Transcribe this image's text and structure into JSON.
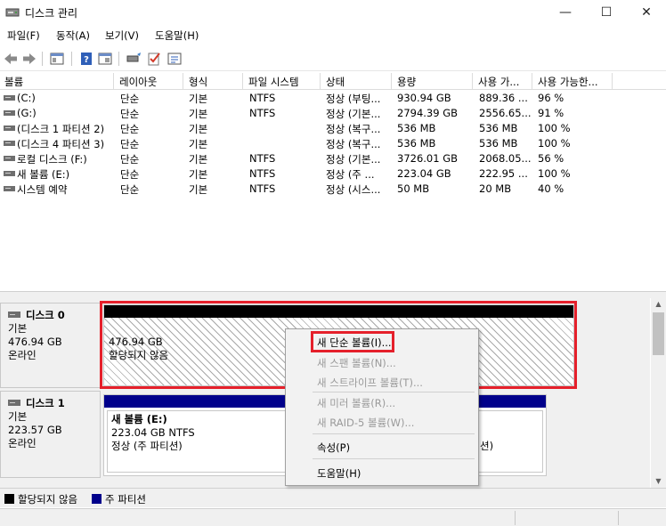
{
  "window": {
    "title": "디스크 관리",
    "minimize": "—",
    "maximize": "☐",
    "close": "✕"
  },
  "menu": [
    "파일(F)",
    "동작(A)",
    "보기(V)",
    "도움말(H)"
  ],
  "volumes": {
    "columns": [
      "볼륨",
      "레이아웃",
      "형식",
      "파일 시스템",
      "상태",
      "용량",
      "사용 가...",
      "사용 가능한..."
    ],
    "rows": [
      [
        "(C:)",
        "단순",
        "기본",
        "NTFS",
        "정상 (부팅...",
        "930.94 GB",
        "889.36 ...",
        "96 %"
      ],
      [
        "(G:)",
        "단순",
        "기본",
        "NTFS",
        "정상 (기본...",
        "2794.39 GB",
        "2556.65...",
        "91 %"
      ],
      [
        "(디스크 1 파티션 2)",
        "단순",
        "기본",
        "",
        "정상 (복구...",
        "536 MB",
        "536 MB",
        "100 %"
      ],
      [
        "(디스크 4 파티션 3)",
        "단순",
        "기본",
        "",
        "정상 (복구...",
        "536 MB",
        "536 MB",
        "100 %"
      ],
      [
        "로컬 디스크 (F:)",
        "단순",
        "기본",
        "NTFS",
        "정상 (기본...",
        "3726.01 GB",
        "2068.05...",
        "56 %"
      ],
      [
        "새 볼륨 (E:)",
        "단순",
        "기본",
        "NTFS",
        "정상 (주 ...",
        "223.04 GB",
        "222.95 ...",
        "100 %"
      ],
      [
        "시스템 예약",
        "단순",
        "기본",
        "NTFS",
        "정상 (시스...",
        "50 MB",
        "20 MB",
        "40 %"
      ]
    ]
  },
  "disks": [
    {
      "name": "디스크 0",
      "type": "기본",
      "size": "476.94 GB",
      "status": "온라인",
      "partition": {
        "size": "476.94 GB",
        "desc": "할당되지 않음"
      }
    },
    {
      "name": "디스크 1",
      "type": "기본",
      "size": "223.57 GB",
      "status": "온라인",
      "partition": {
        "title": "새 볼륨  (E:)",
        "size": "223.04 GB NTFS",
        "status": "정상 (주 파티션)"
      },
      "partition2": {
        "status_tail": "션)"
      }
    }
  ],
  "context_menu": {
    "items": [
      {
        "label": "새 단순 볼륨(I)...",
        "enabled": true
      },
      {
        "label": "새 스팬 볼륨(N)...",
        "enabled": false
      },
      {
        "label": "새 스트라이프 볼륨(T)...",
        "enabled": false
      },
      {
        "label": "새 미러 볼륨(R)...",
        "enabled": false
      },
      {
        "label": "새 RAID-5 볼륨(W)...",
        "enabled": false
      },
      {
        "label": "속성(P)",
        "enabled": true
      },
      {
        "label": "도움말(H)",
        "enabled": true
      }
    ]
  },
  "legend": {
    "unallocated": "할당되지 않음",
    "primary": "주 파티션"
  },
  "colors": {
    "unallocated": "#000000",
    "primary": "#00008b",
    "highlight": "#e5202b"
  },
  "icons": [
    "app-icon",
    "back-icon",
    "forward-icon",
    "panel-icon",
    "help-icon",
    "properties-icon",
    "rescan-icon",
    "check-icon",
    "settings-icon",
    "drive-icon"
  ]
}
